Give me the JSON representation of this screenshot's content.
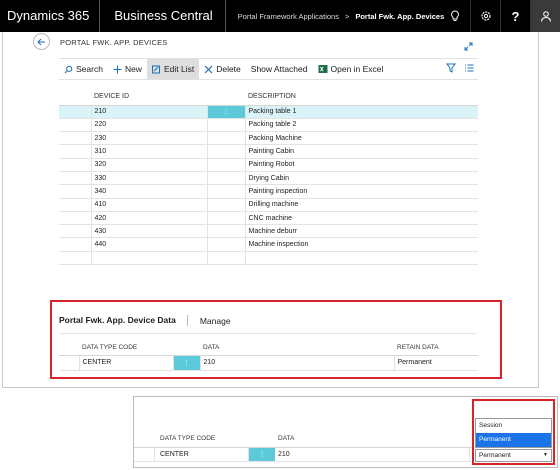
{
  "topbar": {
    "brand": "Dynamics 365",
    "app": "Business Central",
    "breadcrumb_parent": "Portal Framework Applications",
    "breadcrumb_separator": ">",
    "breadcrumb_current": "Portal Fwk. App. Devices",
    "icons": [
      "lightbulb-icon",
      "settings-icon",
      "help-icon",
      "user-icon"
    ],
    "help_label": "?"
  },
  "page": {
    "title": "PORTAL FWK. APP. DEVICES"
  },
  "actions": {
    "search": "Search",
    "new": "New",
    "edit_list": "Edit List",
    "delete": "Delete",
    "show_attached": "Show Attached",
    "open_in_excel": "Open in Excel"
  },
  "grid": {
    "headers": [
      "DEVICE ID",
      "DESCRIPTION"
    ],
    "more_glyph": "⋮",
    "rows": [
      {
        "id": "210",
        "description": "Packing table 1"
      },
      {
        "id": "220",
        "description": "Packing table 2"
      },
      {
        "id": "230",
        "description": "Packing Machine"
      },
      {
        "id": "310",
        "description": "Painting Cabin"
      },
      {
        "id": "320",
        "description": "Painting Robot"
      },
      {
        "id": "330",
        "description": "Drying Cabin"
      },
      {
        "id": "340",
        "description": "Painting inspection"
      },
      {
        "id": "410",
        "description": "Drilling machine"
      },
      {
        "id": "420",
        "description": "CNC machine"
      },
      {
        "id": "430",
        "description": "Machine deburr"
      },
      {
        "id": "440",
        "description": "Machine inspection"
      }
    ]
  },
  "subpart": {
    "tab_title": "Portal Fwk. App. Device Data",
    "tab_manage": "Manage",
    "headers": [
      "DATA TYPE CODE",
      "DATA",
      "RETAIN DATA"
    ],
    "row": {
      "data_type_code": "CENTER",
      "data": "210",
      "retain_data": "Permanent"
    }
  },
  "inset": {
    "headers": [
      "DATA TYPE CODE",
      "DATA"
    ],
    "row": {
      "data_type_code": "CENTER",
      "data": "210"
    },
    "dropdown_options": [
      "Session",
      "Permanent"
    ],
    "dropdown_value": "Permanent",
    "dropdown_arrow": "▼"
  },
  "colors": {
    "accent": "#5ccad8",
    "selected_row": "#d9f3f8",
    "highlight_border": "#d8232a",
    "dropdown_highlight": "#1a73e8"
  }
}
